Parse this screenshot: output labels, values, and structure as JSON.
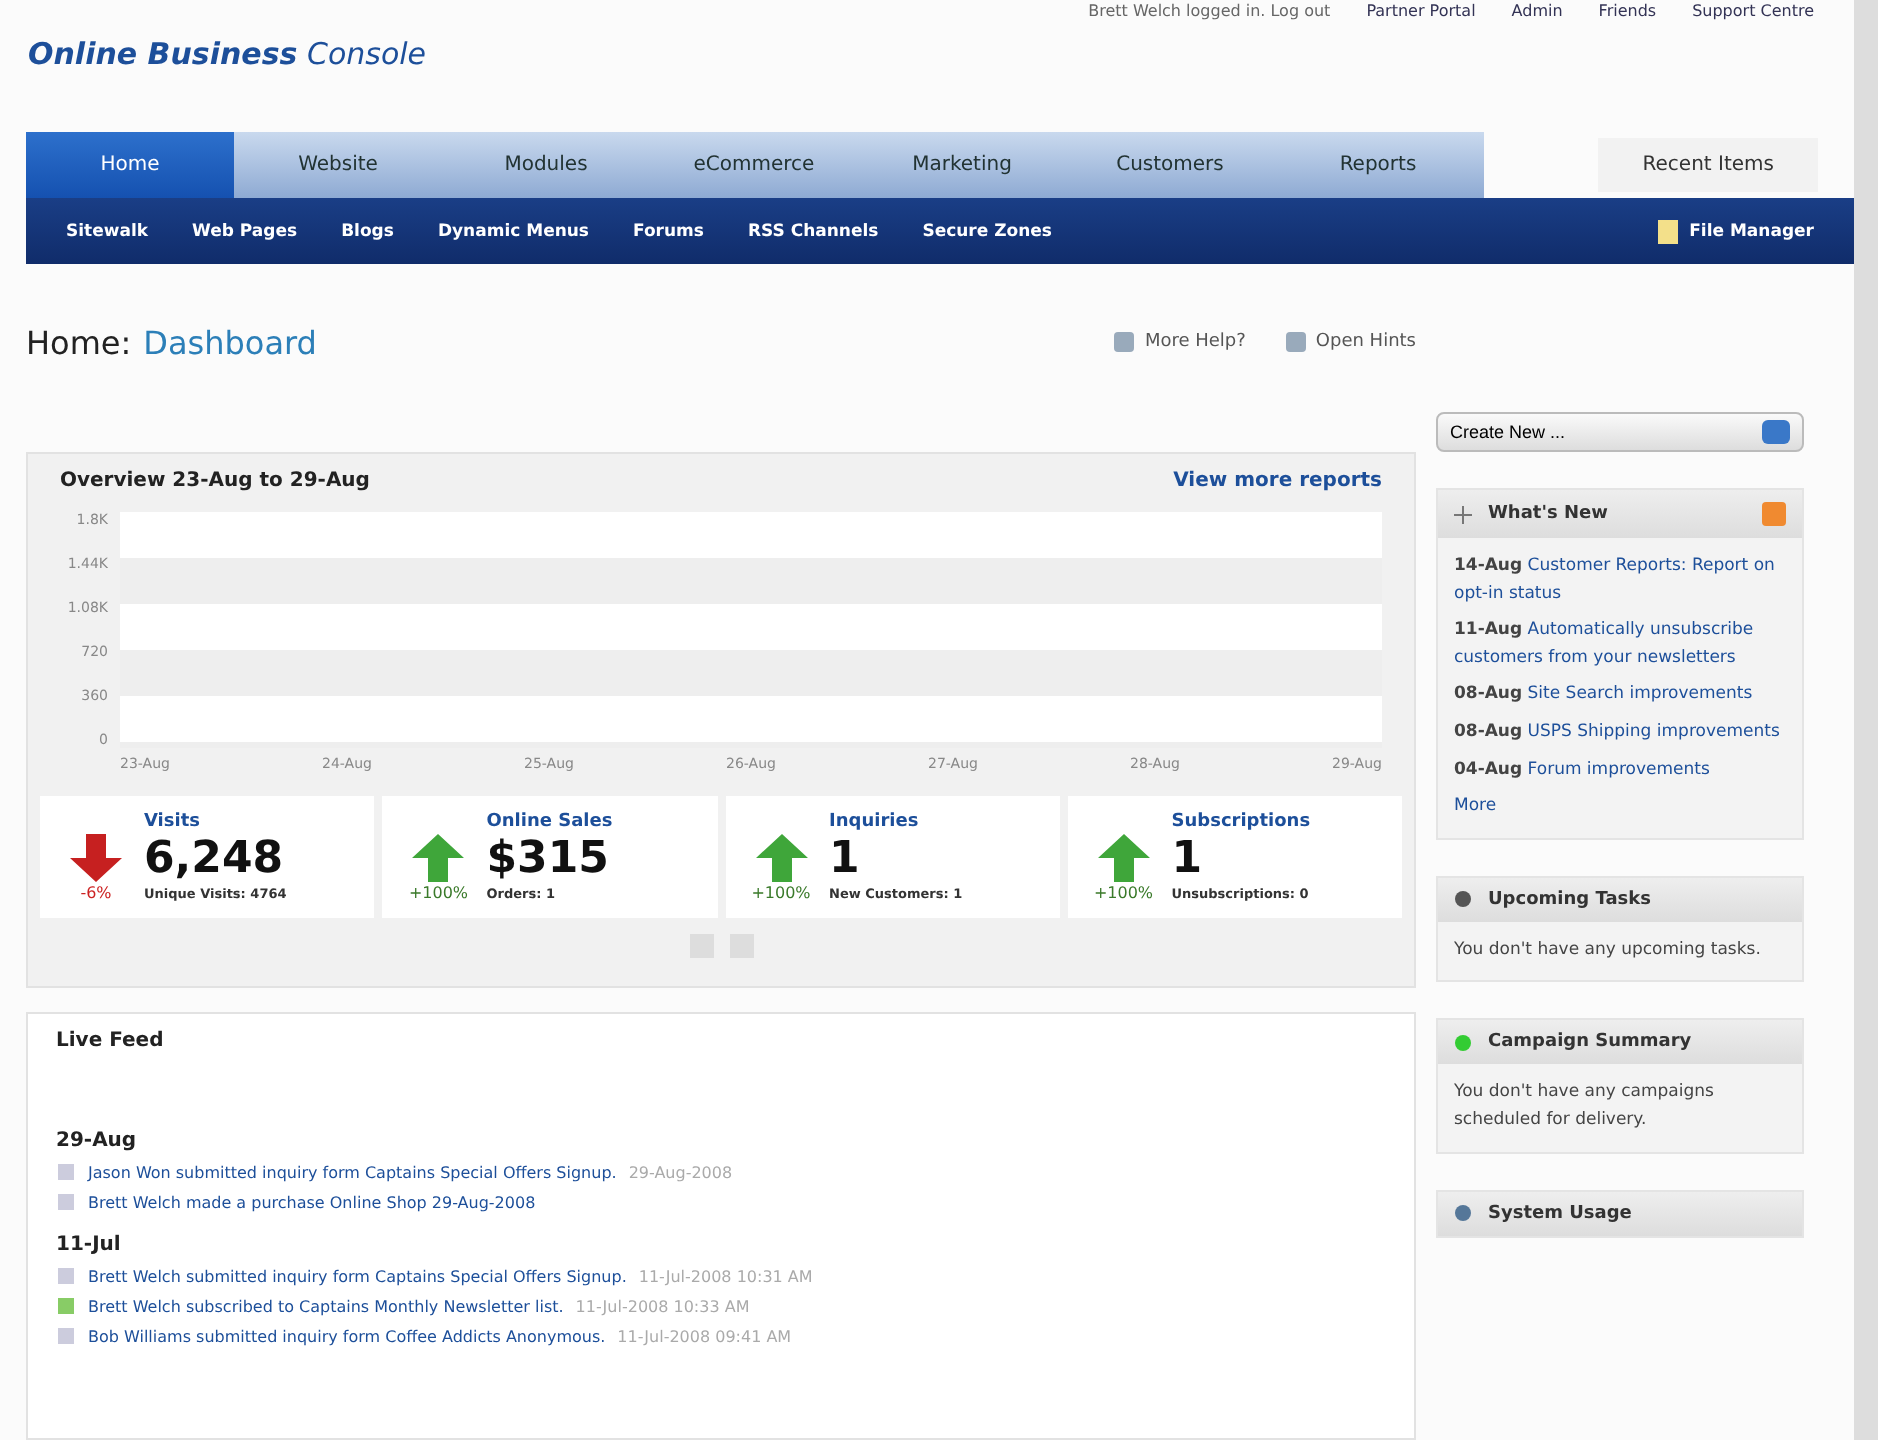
{
  "top_links": [
    {
      "label": "Brett Welch logged in. Log out",
      "kind": "text"
    },
    {
      "label": "Partner Portal",
      "kind": "link"
    },
    {
      "label": "Admin",
      "kind": "link"
    },
    {
      "label": "Friends",
      "kind": "link"
    },
    {
      "label": "Support Centre",
      "kind": "link"
    }
  ],
  "logo": {
    "bold": "Online Business",
    "light": "Console"
  },
  "tabs": [
    {
      "label": "Home",
      "selected": true
    },
    {
      "label": "Website",
      "selected": false
    },
    {
      "label": "Modules",
      "selected": false
    },
    {
      "label": "eCommerce",
      "selected": false
    },
    {
      "label": "Marketing",
      "selected": false
    },
    {
      "label": "Customers",
      "selected": false
    },
    {
      "label": "Reports",
      "selected": false
    }
  ],
  "recent_items": "Recent Items",
  "subnav": [
    "Sitewalk",
    "Web Pages",
    "Blogs",
    "Dynamic Menus",
    "Forums",
    "RSS Channels",
    "Secure Zones"
  ],
  "file_manager": "File Manager",
  "page_title": {
    "section": "Home:",
    "page": "Dashboard"
  },
  "help_links": [
    "More Help?",
    "Open Hints"
  ],
  "overview": {
    "title": "Overview 23-Aug to 29-Aug",
    "link": "View more reports",
    "y_ticks": [
      "1.8K",
      "1.44K",
      "1.08K",
      "720",
      "360",
      "0"
    ],
    "x_labels": [
      "23-Aug",
      "24-Aug",
      "25-Aug",
      "26-Aug",
      "27-Aug",
      "28-Aug",
      "29-Aug"
    ]
  },
  "metrics": [
    {
      "label": "Visits",
      "value": "6,248",
      "change": "-6%",
      "kind": "down",
      "detail": "Unique Visits: 4764"
    },
    {
      "label": "Online Sales",
      "value": "$315",
      "change": "+100%",
      "kind": "up",
      "detail": "Orders: 1"
    },
    {
      "label": "Inquiries",
      "value": "1",
      "change": "+100%",
      "kind": "up",
      "detail": "New Customers: 1"
    },
    {
      "label": "Subscriptions",
      "value": "1",
      "change": "+100%",
      "kind": "up",
      "detail": "Unsubscriptions: 0"
    }
  ],
  "live_feed": {
    "title": "Live Feed",
    "groups": [
      {
        "date": "29-Aug",
        "items": [
          {
            "text": "Jason Won submitted inquiry form Captains Special Offers Signup.",
            "time": "29-Aug-2008",
            "kind": "inquiry"
          },
          {
            "text": "Brett Welch made a purchase Online Shop 29-Aug-2008",
            "kind": "purchase"
          }
        ]
      },
      {
        "date": "11-Jul",
        "items": [
          {
            "text": "Brett Welch submitted inquiry form Captains Special Offers Signup.",
            "time": "11-Jul-2008 10:31 AM",
            "kind": "inquiry"
          },
          {
            "text": "Brett Welch subscribed to Captains Monthly Newsletter list.",
            "time": "11-Jul-2008 10:33 AM",
            "kind": "subscription"
          },
          {
            "text": "Bob Williams submitted inquiry form Coffee Addicts Anonymous.",
            "time": "11-Jul-2008 09:41 AM",
            "kind": "inquiry"
          }
        ]
      }
    ]
  },
  "create_new": "Create New ...",
  "whats_new": {
    "title": "What's New",
    "items": [
      {
        "date": "14-Aug",
        "text": "Customer Reports: Report on opt-in status"
      },
      {
        "date": "11-Aug",
        "text": "Automatically unsubscribe customers from your newsletters"
      },
      {
        "date": "08-Aug",
        "text": "Site Search improvements"
      },
      {
        "date": "08-Aug",
        "text": "USPS Shipping improvements"
      },
      {
        "date": "04-Aug",
        "text": "Forum improvements"
      }
    ],
    "more": "More"
  },
  "panels": [
    {
      "title": "Upcoming Tasks",
      "text": "You don't have any upcoming tasks.",
      "kind": "tasks"
    },
    {
      "title": "Campaign Summary",
      "text": "You don't have any campaigns scheduled for delivery.",
      "kind": "campaign"
    },
    {
      "title": "System Usage",
      "kind": "usage"
    }
  ]
}
